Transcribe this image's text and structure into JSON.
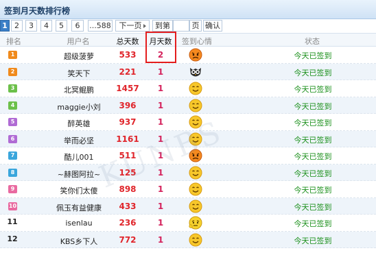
{
  "header": {
    "title": "签到月天数排行榜"
  },
  "pager": {
    "pages": [
      "1",
      "2",
      "3",
      "4",
      "5",
      "6",
      "...588"
    ],
    "current": "1",
    "next_label": "下一页",
    "goto_label": "到第",
    "page_unit": "页",
    "confirm_label": "确认",
    "goto_value": ""
  },
  "table": {
    "headers": {
      "rank": "排名",
      "user": "用户名",
      "total": "总天数",
      "month": "月天数",
      "mood": "签到心情",
      "status": "状态"
    },
    "rows": [
      {
        "rank": "1",
        "user": "超级菠萝",
        "total": "533",
        "month": "2",
        "mood": "angry-face-icon",
        "status": "今天已签到"
      },
      {
        "rank": "2",
        "user": "笑天下",
        "total": "221",
        "month": "1",
        "mood": "owl-face-icon",
        "status": "今天已签到"
      },
      {
        "rank": "3",
        "user": "北冥鲲鹏",
        "total": "1457",
        "month": "1",
        "mood": "smile-face-icon",
        "status": "今天已签到"
      },
      {
        "rank": "4",
        "user": "maggie小刘",
        "total": "396",
        "month": "1",
        "mood": "smile-face-icon",
        "status": "今天已签到"
      },
      {
        "rank": "5",
        "user": "醉英雄",
        "total": "937",
        "month": "1",
        "mood": "smile-face-icon",
        "status": "今天已签到"
      },
      {
        "rank": "6",
        "user": "举而必坚",
        "total": "1161",
        "month": "1",
        "mood": "smile-face-icon",
        "status": "今天已签到"
      },
      {
        "rank": "7",
        "user": "酷儿001",
        "total": "511",
        "month": "1",
        "mood": "angry-face-icon",
        "status": "今天已签到"
      },
      {
        "rank": "8",
        "user": "~赫图阿拉~",
        "total": "125",
        "month": "1",
        "mood": "smile-face-icon",
        "status": "今天已签到"
      },
      {
        "rank": "9",
        "user": "笑你们太傻",
        "total": "898",
        "month": "1",
        "mood": "smile-face-icon",
        "status": "今天已签到"
      },
      {
        "rank": "10",
        "user": "佩玉有益健康",
        "total": "433",
        "month": "1",
        "mood": "smile-face-icon",
        "status": "今天已签到"
      },
      {
        "rank": "11",
        "user": "isenlau",
        "total": "236",
        "month": "1",
        "mood": "thinking-face-icon",
        "status": "今天已签到"
      },
      {
        "rank": "12",
        "user": "KBS乡下人",
        "total": "772",
        "month": "1",
        "mood": "smile-face-icon",
        "status": "今天已签到"
      }
    ]
  },
  "colors": {
    "rank_badges": [
      "#f08a1c",
      "#f08a1c",
      "#6cc04a",
      "#6cc04a",
      "#b06bd4",
      "#b06bd4",
      "#3aa6dc",
      "#3aa6dc",
      "#e96aa0",
      "#e96aa0"
    ],
    "total": "#e0252b",
    "month": "#d4225c",
    "status": "#1a8f1a",
    "highlight": "#e41c1c"
  },
  "watermark": "KUNBS"
}
